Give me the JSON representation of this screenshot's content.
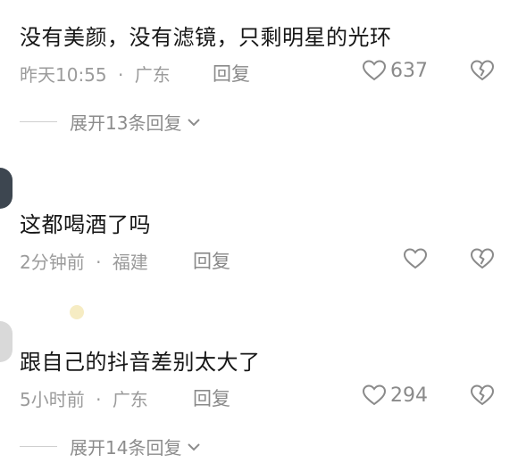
{
  "comments": [
    {
      "name": "",
      "text": "没有美颜，没有滤镜，只剩明星的光环",
      "time": "昨天10:55",
      "location": "广东",
      "reply_label": "回复",
      "likes": "637",
      "expand_label": "展开13条回复"
    },
    {
      "name": "",
      "text": "这都喝酒了吗",
      "time": "2分钟前",
      "location": "福建",
      "reply_label": "回复",
      "likes": ""
    },
    {
      "name": "",
      "text": "跟自己的抖音差别太大了",
      "time": "5小时前",
      "location": "广东",
      "reply_label": "回复",
      "likes": "294",
      "expand_label": "展开14条回复"
    }
  ],
  "dot": "·",
  "icons": {
    "like": "heart-outline-icon",
    "dislike": "broken-heart-icon",
    "expand": "chevron-down-icon"
  },
  "colors": {
    "text": "#161616",
    "meta": "#9b9b9b",
    "icon": "#8a8a8a",
    "avatar": "#3d4650"
  }
}
